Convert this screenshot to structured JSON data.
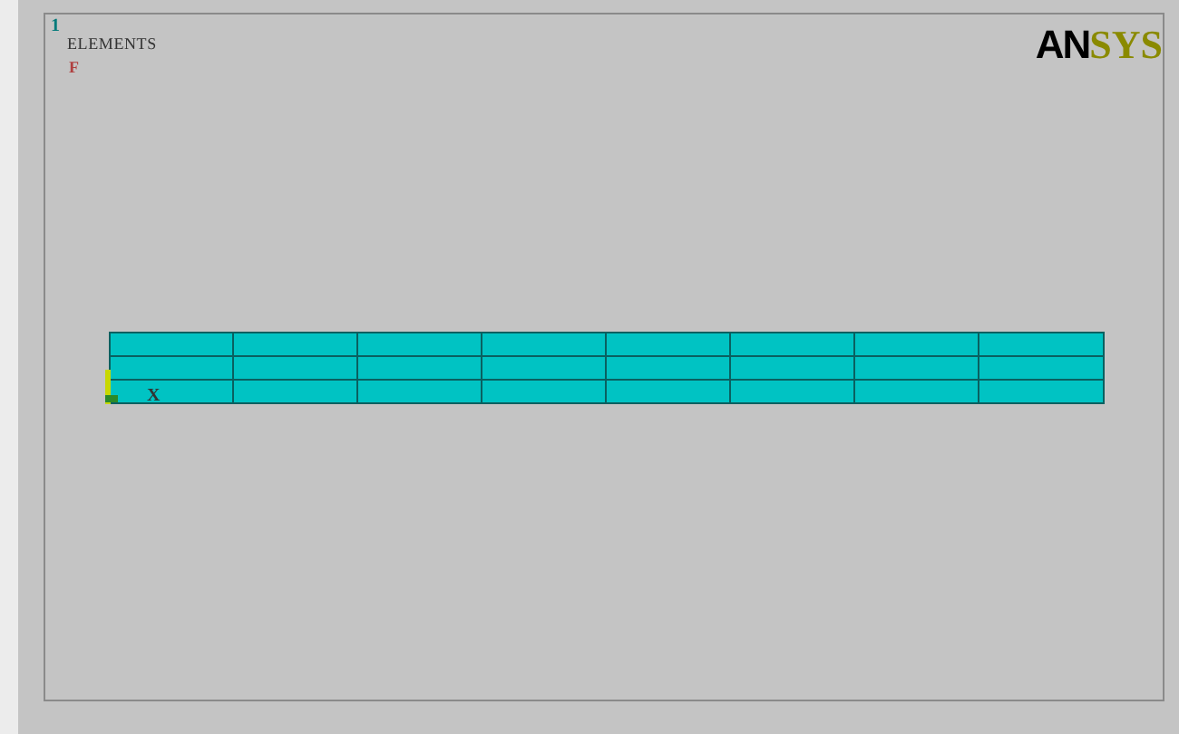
{
  "viewport": {
    "window_number": "1",
    "title": "ELEMENTS",
    "marker": "F",
    "axis_label": "X",
    "logo": {
      "dark": "AN",
      "light": "SYS"
    }
  }
}
